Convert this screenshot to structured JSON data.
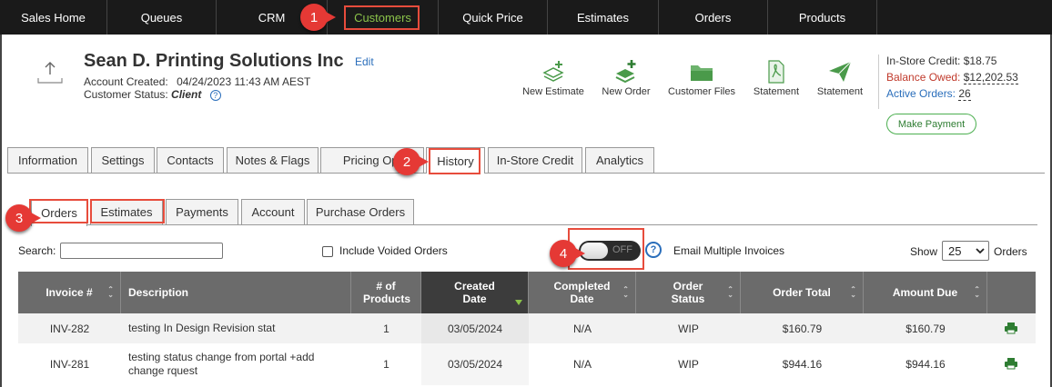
{
  "nav": {
    "items": [
      "Sales Home",
      "Queues",
      "CRM",
      "Customers",
      "Quick Price",
      "Estimates",
      "Orders",
      "Products"
    ],
    "active": "Customers"
  },
  "customer": {
    "name": "Sean D. Printing Solutions Inc",
    "edit_label": "Edit",
    "account_created_label": "Account Created:",
    "account_created": "04/24/2023 11:43 AM AEST",
    "status_label": "Customer Status:",
    "status": "Client"
  },
  "actions": [
    "New Estimate",
    "New Order",
    "Customer Files",
    "Statement",
    "Statement"
  ],
  "account_summary": {
    "credit_label": "In-Store Credit:",
    "credit_value": "$18.75",
    "balance_label": "Balance Owed:",
    "balance_value": "$12,202.53",
    "active_orders_label": "Active Orders:",
    "active_orders_value": "26",
    "make_payment_label": "Make Payment"
  },
  "tabs": [
    "Information",
    "Settings",
    "Contacts",
    "Notes & Flags",
    "Pricing Opt",
    "History",
    "In-Store Credit",
    "Analytics"
  ],
  "active_tab": "History",
  "subtabs": [
    "Orders",
    "Estimates",
    "Payments",
    "Account",
    "Purchase Orders"
  ],
  "active_subtab": "Orders",
  "callouts": [
    "1",
    "2",
    "3",
    "4"
  ],
  "filters": {
    "search_label": "Search:",
    "search_value": "",
    "include_voided_label": "Include Voided Orders",
    "toggle_label": "OFF",
    "help_symbol": "?",
    "email_multiple_label": "Email Multiple Invoices",
    "show_label": "Show",
    "page_size": "25",
    "orders_label": "Orders"
  },
  "table": {
    "columns": [
      "Invoice #",
      "Description",
      "# of Products",
      "Created Date",
      "Completed Date",
      "Order Status",
      "Order Total",
      "Amount Due",
      ""
    ],
    "rows": [
      [
        "INV-282",
        "testing In Design Revision stat",
        "1",
        "03/05/2024",
        "N/A",
        "WIP",
        "$160.79",
        "$160.79"
      ],
      [
        "INV-281",
        "testing status change from portal +add change rquest",
        "1",
        "03/05/2024",
        "N/A",
        "WIP",
        "$944.16",
        "$944.16"
      ]
    ]
  },
  "colors": {
    "nav_bg": "#1a1a1a",
    "nav_active": "#8bc34a",
    "annotation": "#e53935",
    "balance_owed": "#c0392b",
    "link": "#2a6ebb",
    "table_header": "#6b6b6b",
    "print_icon": "#2e7d32"
  }
}
